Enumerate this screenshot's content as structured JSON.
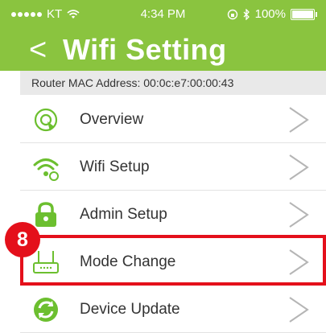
{
  "status_bar": {
    "carrier": "KT",
    "time": "4:34 PM",
    "battery": "100%"
  },
  "header": {
    "back_label": "<",
    "title": "Wifi Setting"
  },
  "mac_bar": {
    "text": "Router MAC Address: 00:0c:e7:00:00:43"
  },
  "menu": {
    "items": [
      {
        "label": "Overview",
        "icon": "overview-icon"
      },
      {
        "label": "Wifi Setup",
        "icon": "wifi-icon"
      },
      {
        "label": "Admin Setup",
        "icon": "lock-icon"
      },
      {
        "label": "Mode Change",
        "icon": "router-icon"
      },
      {
        "label": "Device Update",
        "icon": "update-icon"
      }
    ]
  },
  "annotation": {
    "step_number": "8",
    "color": "#e4101b"
  },
  "colors": {
    "header": "#8ac43f",
    "icon_green": "#6cbf2f"
  }
}
